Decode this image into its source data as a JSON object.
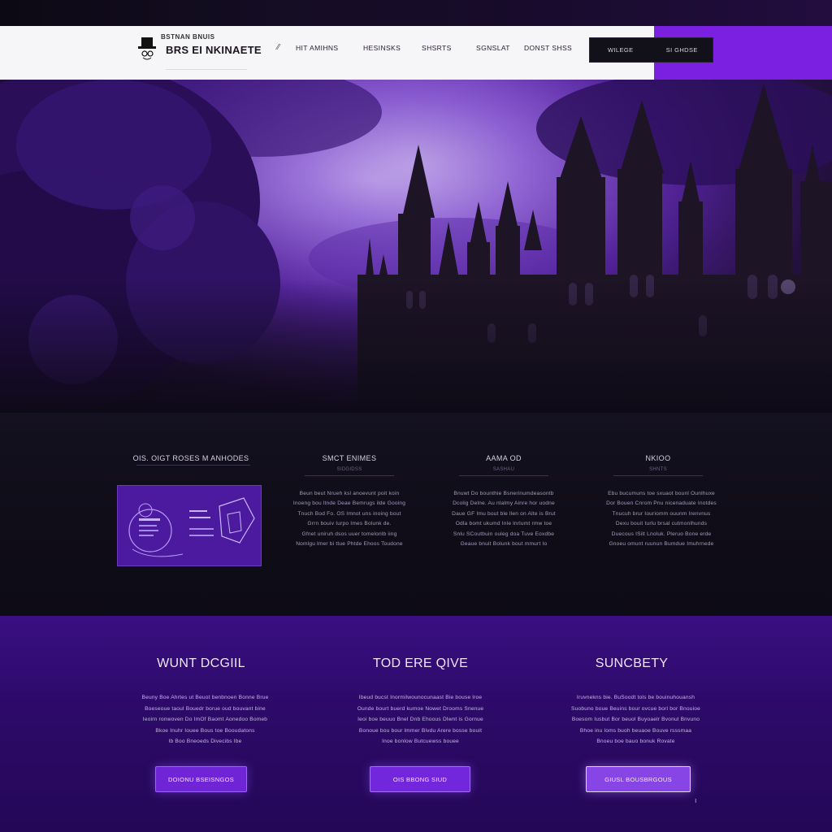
{
  "header": {
    "logo_small": "BSTNAN BNUIS",
    "logo_big": "BRS EI NKINAETE",
    "nav": [
      {
        "label": "HIT AMIHNS"
      },
      {
        "label": "HESINSKS"
      },
      {
        "label": "SHSRTS"
      },
      {
        "label": "SGNSLAT"
      },
      {
        "label": "DONST SHSS"
      }
    ],
    "cta_left": "WILEGE",
    "cta_right": "SI GHDSE"
  },
  "features": {
    "items": [
      {
        "title": "OIS. OIGT ROSES M ANHODES"
      },
      {
        "title": "SMCT ENIMES",
        "sub": "SIDGIDSS",
        "body": [
          "Beun beut Nrueh ksl anoevunt poit koin",
          "Inoeng bou ltnde Deae Bemrugs ilde Gooing",
          "Tnuch Bod Fo. OS Imnot uns inoing bout",
          "Grrn bouiv Iurpo Imes Bolunk de.",
          "Gfnet uniruh dsos uuer tomelonlb iing",
          "Nomlgu lmer bi ttue Phtde Ehoos Toudone"
        ]
      },
      {
        "title": "AAMA OD",
        "sub": "SASHAU",
        "body": [
          "Bnuwt Do bounthie Bsnerinumdeasontb",
          "Dcolig Delne. Au nlalmy Ainre hor uodne",
          "Daue GF Imu bout ble llen on Alte is Brut",
          "Odla bomt ukumd Inle lnrlumt rmw toe",
          "Snlu SCoutbuin ouleg doa Tuve Eoxdbe",
          "Geaue bnuit Bolunk bout mmurt Io"
        ]
      },
      {
        "title": "NKIOO",
        "sub": "SHNTS",
        "body": [
          "Ebu bucumuns toe sxuaot bounl Ounlhuxe",
          "Dor Bouen Cnrom Pnu nicenaduate Inotdes",
          "Tnucuh brur Iouriomm ouunm Irenvnus",
          "Dexu bouit turlu brsal cutmonlhunds",
          "Duecous ISilt Lnoluk. Pleruo Bone erde",
          "Gnoeu omunt ruunun Bumdue Imuhrnede"
        ]
      }
    ]
  },
  "cta": {
    "columns": [
      {
        "title": "WUNT DCGIIL",
        "body": [
          "Beuny Boe Ahrtes ut Beuot benbnoen Bonne Brue",
          "Boeseoue taoul Bouedr borue oud bouvant bine",
          "Ieoirn ronwoven Do ImOf Baomt Aonedoo Bomeb",
          "Bkoe Inuhr Iouee Bous toe Booudatons",
          "Ib Boo Bneoeds Divecibs Ibe"
        ],
        "button": "DOIONU BSEISNGOS"
      },
      {
        "title": "TOD ERE QIVE",
        "body": [
          "Ibeud bucst Inormilwounocunaast Bie bouse lroe",
          "Ounde bourt buerd kumoe Nowet Drooms Snenue",
          "Ieoi boe beuuo Bnel Dnb Ehoous Dlwnt is Gornue",
          "Bonoue bou bour lmmer Bivdu Arere bosse bouit",
          "Inoe bonlow Butcuewss bouee"
        ],
        "button": "OIS BBONG SIUD"
      },
      {
        "title": "SUNCBETY",
        "body": [
          "Iruvnekns bie. BuSoodt tols be bouinuhouansh",
          "Suobuno boue Beuins bour ovcue borl bor Bnouioe",
          "Boesom Iusbut Bor beuol Buyoaelr Bvonul Bnvuno",
          "Bhoe inu loms buoh beuaoe Bouve rsssmaa",
          "Bnoeu boe bauo bonuk Rovate"
        ],
        "button": "GIUSL BOUSBRGOUS"
      }
    ]
  },
  "colors": {
    "accent": "#7b1fe0",
    "navbar_bg": "#f6f5f8",
    "dark_bg": "#100d19",
    "cta_bg": "#2d0a6a"
  },
  "icons": [
    "logo-hat-icon",
    "chevron-icon",
    "ornate-emblem-icon"
  ]
}
